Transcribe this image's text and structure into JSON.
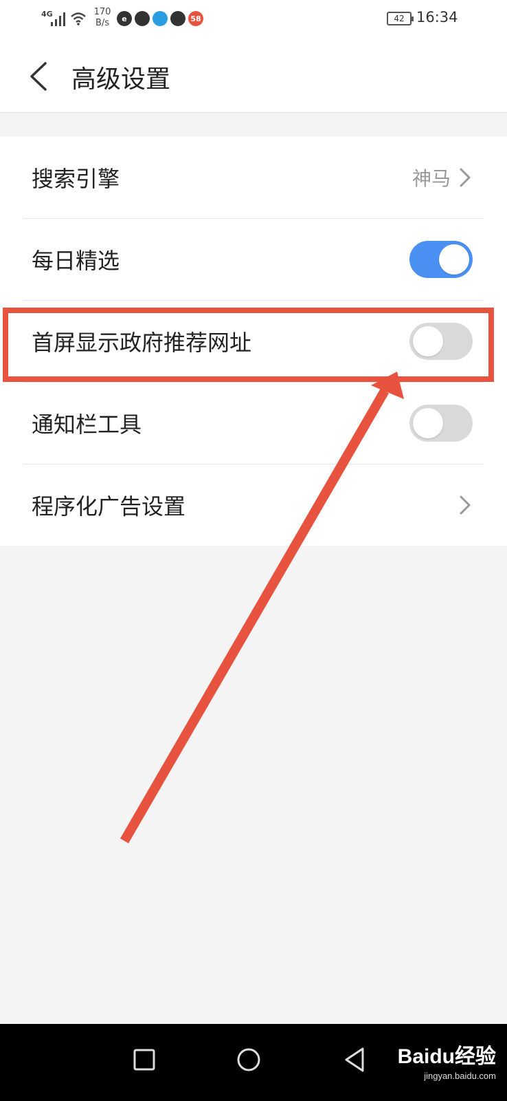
{
  "status_bar": {
    "network": "4G",
    "speed": "170",
    "speed_unit": "B/s",
    "battery": "42",
    "time": "16:34",
    "app_icons": [
      {
        "name": "browser-app-icon",
        "label": "e",
        "color": "#333333"
      },
      {
        "name": "aperture-app-icon",
        "label": "",
        "color": "#333333"
      },
      {
        "name": "colorful-app-icon",
        "label": "",
        "color": "#2a9de0"
      },
      {
        "name": "message-app-icon",
        "label": "",
        "color": "#333333"
      },
      {
        "name": "58-app-icon",
        "label": "58",
        "color": "#e8533f"
      }
    ]
  },
  "header": {
    "title": "高级设置"
  },
  "settings": [
    {
      "label": "搜索引擎",
      "type": "link",
      "value": "神马"
    },
    {
      "label": "每日精选",
      "type": "toggle",
      "on": true
    },
    {
      "label": "首屏显示政府推荐网址",
      "type": "toggle",
      "on": false
    },
    {
      "label": "通知栏工具",
      "type": "toggle",
      "on": false
    },
    {
      "label": "程序化广告设置",
      "type": "link",
      "value": ""
    }
  ],
  "colors": {
    "toggle_on": "#4a90f2",
    "toggle_off": "#d9d9d9",
    "annotation": "#e8533f"
  },
  "watermark": {
    "text": "Baidu经验",
    "sub": "jingyan.baidu.com"
  }
}
